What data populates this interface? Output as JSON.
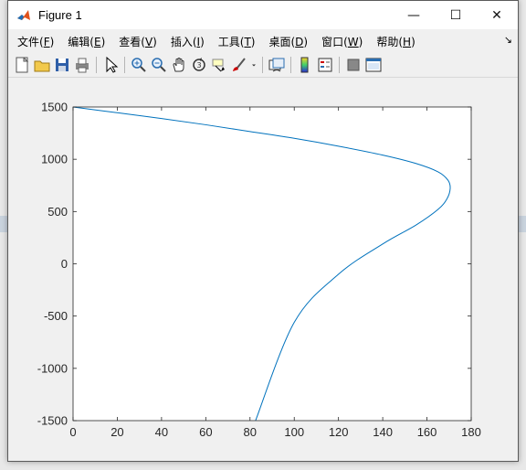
{
  "window": {
    "title": "Figure 1"
  },
  "window_buttons": {
    "minimize": "—",
    "maximize": "☐",
    "close": "✕"
  },
  "menu": [
    {
      "label": "文件(",
      "key": "F",
      "tail": ")"
    },
    {
      "label": "编辑(",
      "key": "E",
      "tail": ")"
    },
    {
      "label": "查看(",
      "key": "V",
      "tail": ")"
    },
    {
      "label": "插入(",
      "key": "I",
      "tail": ")"
    },
    {
      "label": "工具(",
      "key": "T",
      "tail": ")"
    },
    {
      "label": "桌面(",
      "key": "D",
      "tail": ")"
    },
    {
      "label": "窗口(",
      "key": "W",
      "tail": ")"
    },
    {
      "label": "帮助(",
      "key": "H",
      "tail": ")"
    }
  ],
  "toolbar_icons": [
    "new-figure-icon",
    "open-file-icon",
    "save-icon",
    "print-icon",
    "|",
    "select-arrow-icon",
    "|",
    "zoom-in-icon",
    "zoom-out-icon",
    "pan-hand-icon",
    "rotate-3d-icon",
    "data-cursor-icon",
    "brush-icon",
    "brush-dropdown-icon",
    "|",
    "link-plot-icon",
    "|",
    "colorbar-icon",
    "legend-icon",
    "|",
    "hide-plot-tools-icon",
    "show-plot-tools-icon"
  ],
  "colors": {
    "line": "#0072bd",
    "axes_bg": "#ffffff",
    "figure_bg": "#f0f0f0"
  },
  "chart_data": {
    "type": "line",
    "title": "",
    "xlabel": "",
    "ylabel": "",
    "xlim": [
      0,
      180
    ],
    "ylim": [
      -1500,
      1500
    ],
    "xticks": [
      0,
      20,
      40,
      60,
      80,
      100,
      120,
      140,
      160,
      180
    ],
    "yticks": [
      -1500,
      -1000,
      -500,
      0,
      500,
      1000,
      1500
    ],
    "grid": false,
    "series": [
      {
        "x": [
          0,
          20,
          40,
          60,
          80,
          100,
          120,
          140,
          155,
          165,
          169.5,
          170.5,
          169,
          165,
          155,
          140,
          120,
          100,
          82.5
        ],
        "y": [
          1500,
          1445,
          1390,
          1330,
          1265,
          1200,
          1125,
          1040,
          960,
          880,
          800,
          720,
          620,
          520,
          370,
          190,
          -100,
          -560,
          -1500
        ]
      }
    ]
  }
}
